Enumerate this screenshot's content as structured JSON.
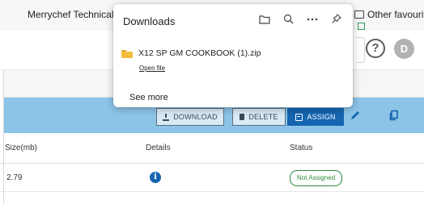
{
  "bookmarks": {
    "merrychef": "Merrychef Technical...",
    "other_favourites": "Other favourites"
  },
  "header": {
    "help_icon": "question-circle-icon",
    "avatar_initial": "D"
  },
  "downloads_panel": {
    "title": "Downloads",
    "icons": [
      "folder-icon",
      "search-icon",
      "more-icon",
      "pin-icon"
    ],
    "file_name": "X12 SP GM COOKBOOK (1).zip",
    "open_file": "Open file",
    "see_more": "See more"
  },
  "toolbar": {
    "download_label": "DOWNLOAD",
    "delete_label": "DELETE",
    "assign_label": "ASSIGN",
    "colors": {
      "bar": "#8cc4e8",
      "assign": "#1565b0"
    }
  },
  "table": {
    "headers": [
      "Size(mb)",
      "Details",
      "Status"
    ],
    "rows": [
      {
        "size": "2.79",
        "details_icon": "info-icon",
        "status": "Not Assigned"
      }
    ]
  }
}
